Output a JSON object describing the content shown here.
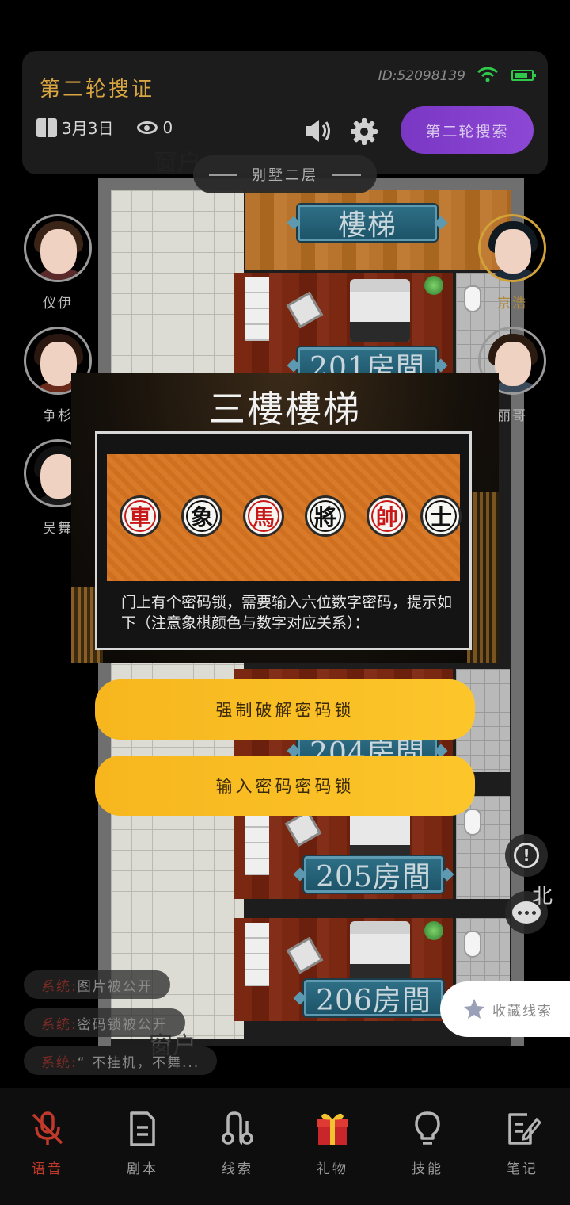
{
  "header": {
    "round_title": "第二轮搜证",
    "date": "3月3日",
    "viewer_count": "0",
    "user_id": "ID:52098139",
    "search_button": "第二轮搜索"
  },
  "location": "别墅二层",
  "map": {
    "labels": {
      "window_top": "窗户",
      "stairs": "樓梯",
      "room_201": "201房間",
      "room_204": "204房間",
      "room_205": "205房間",
      "room_206": "206房間",
      "window_bottom": "窗户"
    },
    "compass": "北"
  },
  "players_left": [
    {
      "name": "仪伊"
    },
    {
      "name": "争杉"
    },
    {
      "name": "吴舞"
    }
  ],
  "players_right": [
    {
      "name": "京浩"
    },
    {
      "name": "丽哥"
    }
  ],
  "clue": {
    "title": "三樓樓梯",
    "pieces": [
      {
        "char": "車",
        "color": "red"
      },
      {
        "char": "象",
        "color": "black"
      },
      {
        "char": "馬",
        "color": "red"
      },
      {
        "char": "將",
        "color": "black"
      },
      {
        "char": "帥",
        "color": "red"
      },
      {
        "char": "士",
        "color": "black"
      }
    ],
    "text": "门上有个密码锁，需要输入六位数字密码，提示如下（注意象棋颜色与数字对应关系）："
  },
  "actions": {
    "force_unlock": "强制破解密码锁",
    "enter_password": "输入密码密码锁"
  },
  "collect_clue": "收藏线索",
  "system_messages": [
    {
      "tag": "系统:",
      "text": "图片被公开"
    },
    {
      "tag": "系统:",
      "text": "密码锁被公开"
    },
    {
      "tag": "系统:",
      "text": "“ 不挂机，不舞..."
    }
  ],
  "bottom_nav": [
    {
      "label": "语音",
      "icon": "microphone-muted-icon",
      "active": true
    },
    {
      "label": "剧本",
      "icon": "document-icon",
      "active": false
    },
    {
      "label": "线索",
      "icon": "clue-path-icon",
      "active": false
    },
    {
      "label": "礼物",
      "icon": "gift-icon",
      "active": false
    },
    {
      "label": "技能",
      "icon": "lightbulb-icon",
      "active": false
    },
    {
      "label": "笔记",
      "icon": "note-edit-icon",
      "active": false
    }
  ],
  "colors": {
    "accent_purple": "#8c48d4",
    "action_yellow": "#fcc62b",
    "title_gold": "#d9a642",
    "nav_active": "#c0392b"
  }
}
